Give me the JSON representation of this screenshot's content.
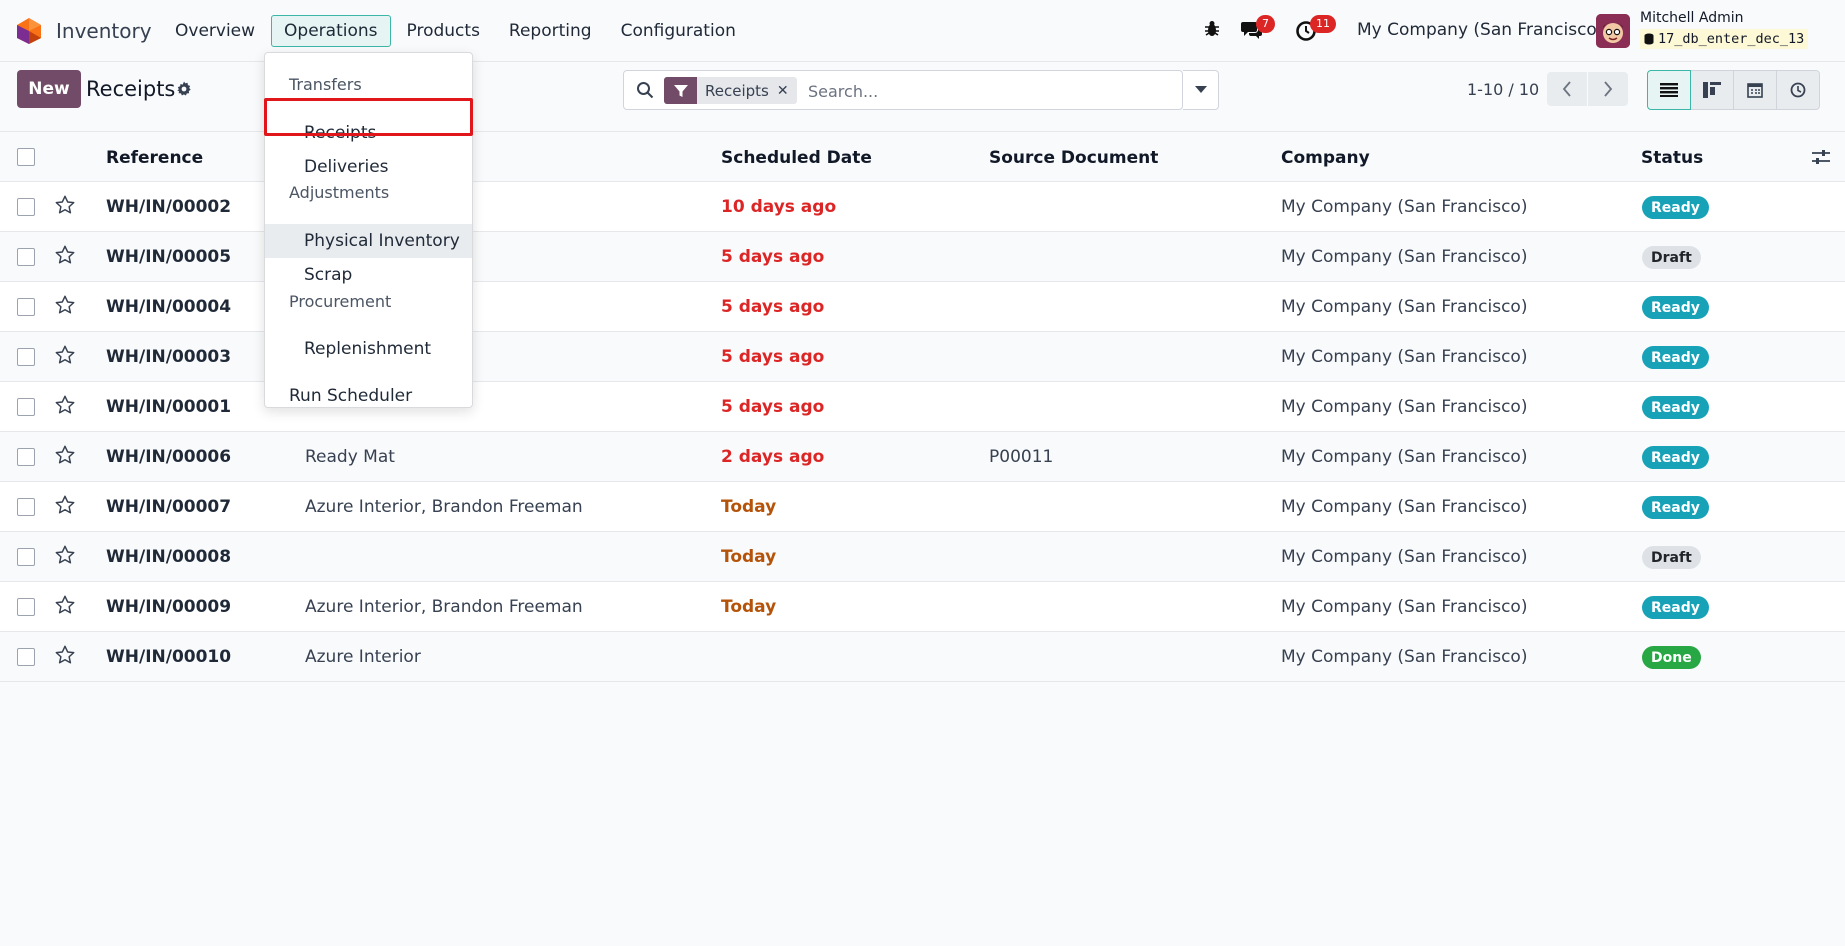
{
  "app": {
    "name": "Inventory"
  },
  "nav": {
    "menu": [
      "Overview",
      "Operations",
      "Products",
      "Reporting",
      "Configuration"
    ],
    "active": "Operations",
    "messages_badge": "7",
    "activities_badge": "11",
    "company": "My Company (San Francisco)",
    "user_name": "Mitchell Admin",
    "db_name": "17_db_enter_dec_13"
  },
  "control": {
    "new_label": "New",
    "breadcrumb": "Receipts",
    "facet_label": "Receipts",
    "search_placeholder": "Search...",
    "pager": "1-10 / 10"
  },
  "dropdown": {
    "sections": [
      {
        "header": "Transfers",
        "items": [
          "Receipts",
          "Deliveries"
        ]
      },
      {
        "header": "Adjustments",
        "items": [
          "Physical Inventory",
          "Scrap"
        ]
      },
      {
        "header": "Procurement",
        "items": [
          "Replenishment"
        ]
      }
    ],
    "footer_item": "Run Scheduler",
    "highlighted": "Receipts",
    "hovered": "Physical Inventory"
  },
  "table": {
    "columns": [
      "Reference",
      "Scheduled Date",
      "Source Document",
      "Company",
      "Status"
    ],
    "rows": [
      {
        "reference": "WH/IN/00002",
        "contact": "",
        "date": "10 days ago",
        "date_state": "late",
        "source": "",
        "company": "My Company (San Francisco)",
        "status": "Ready"
      },
      {
        "reference": "WH/IN/00005",
        "contact": "",
        "date": "5 days ago",
        "date_state": "late",
        "source": "",
        "company": "My Company (San Francisco)",
        "status": "Draft"
      },
      {
        "reference": "WH/IN/00004",
        "contact": "",
        "date": "5 days ago",
        "date_state": "late",
        "source": "",
        "company": "My Company (San Francisco)",
        "status": "Ready"
      },
      {
        "reference": "WH/IN/00003",
        "contact": "",
        "date": "5 days ago",
        "date_state": "late",
        "source": "",
        "company": "My Company (San Francisco)",
        "status": "Ready"
      },
      {
        "reference": "WH/IN/00001",
        "contact": "",
        "date": "5 days ago",
        "date_state": "late",
        "source": "",
        "company": "My Company (San Francisco)",
        "status": "Ready"
      },
      {
        "reference": "WH/IN/00006",
        "contact": "Ready Mat",
        "date": "2 days ago",
        "date_state": "late",
        "source": "P00011",
        "company": "My Company (San Francisco)",
        "status": "Ready"
      },
      {
        "reference": "WH/IN/00007",
        "contact": "Azure Interior, Brandon Freeman",
        "date": "Today",
        "date_state": "today",
        "source": "",
        "company": "My Company (San Francisco)",
        "status": "Ready"
      },
      {
        "reference": "WH/IN/00008",
        "contact": "",
        "date": "Today",
        "date_state": "today",
        "source": "",
        "company": "My Company (San Francisco)",
        "status": "Draft"
      },
      {
        "reference": "WH/IN/00009",
        "contact": "Azure Interior, Brandon Freeman",
        "date": "Today",
        "date_state": "today",
        "source": "",
        "company": "My Company (San Francisco)",
        "status": "Ready"
      },
      {
        "reference": "WH/IN/00010",
        "contact": "Azure Interior",
        "date": "",
        "date_state": "none",
        "source": "",
        "company": "My Company (San Francisco)",
        "status": "Done"
      }
    ]
  }
}
